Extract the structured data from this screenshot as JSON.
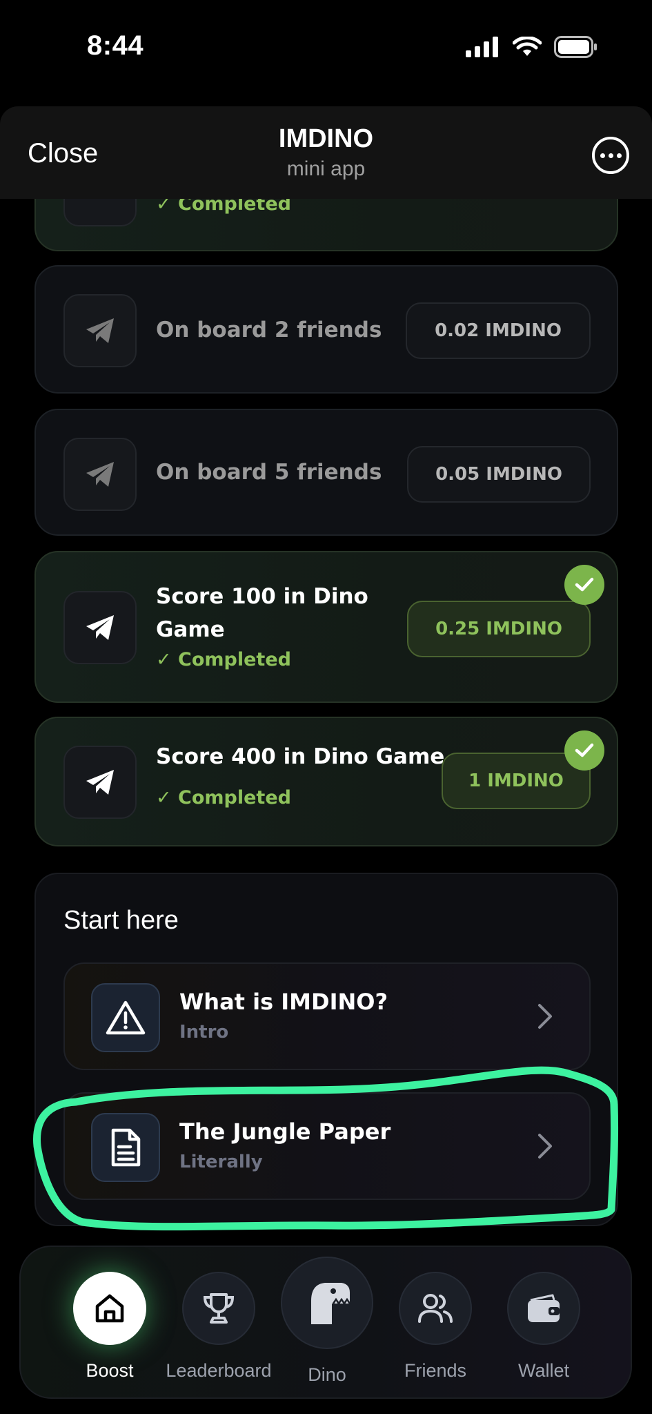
{
  "status_bar": {
    "time": "8:44"
  },
  "header": {
    "close_label": "Close",
    "title": "IMDINO",
    "subtitle": "mini app"
  },
  "tasks": [
    {
      "title": "",
      "status": "✓ Completed",
      "reward": "",
      "completed": true,
      "icon": "telegram-icon"
    },
    {
      "title": "On board 2 friends",
      "status": "",
      "reward": "0.02 IMDINO",
      "completed": false,
      "icon": "telegram-icon"
    },
    {
      "title": "On board 5 friends",
      "status": "",
      "reward": "0.05 IMDINO",
      "completed": false,
      "icon": "telegram-icon"
    },
    {
      "title_line1": "Score 100 in Dino",
      "title_line2": "Game",
      "status": "✓ Completed",
      "reward": "0.25 IMDINO",
      "completed": true,
      "icon": "telegram-icon"
    },
    {
      "title": "Score 400 in Dino Game",
      "status": "✓ Completed",
      "reward": "1 IMDINO",
      "completed": true,
      "icon": "telegram-icon"
    }
  ],
  "start_here": {
    "title": "Start here",
    "items": [
      {
        "title": "What is IMDINO?",
        "subtitle": "Intro",
        "icon": "warning-icon"
      },
      {
        "title": "The Jungle Paper",
        "subtitle": "Literally",
        "icon": "document-icon"
      }
    ]
  },
  "nav": [
    {
      "label": "Boost",
      "icon": "home-icon",
      "active": true
    },
    {
      "label": "Leaderboard",
      "icon": "trophy-icon",
      "active": false
    },
    {
      "label": "Dino",
      "icon": "dino-icon",
      "active": false
    },
    {
      "label": "Friends",
      "icon": "friends-icon",
      "active": false
    },
    {
      "label": "Wallet",
      "icon": "wallet-icon",
      "active": false
    }
  ],
  "colors": {
    "accent_green": "#8fc25c",
    "highlight_stroke": "#3df2a0",
    "badge_green": "#7cb54b"
  }
}
